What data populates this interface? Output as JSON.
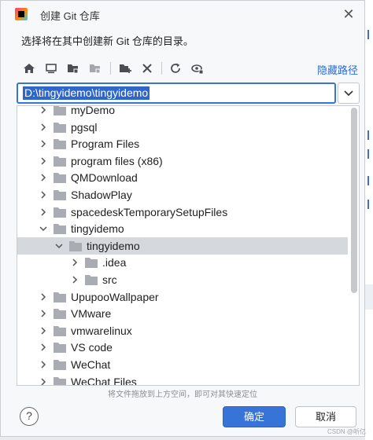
{
  "window": {
    "title": "创建 Git 仓库",
    "close_glyph": "✕"
  },
  "prompt": "选择将在其中创建新 Git 仓库的目录。",
  "toolbar": {
    "icons": [
      "home-icon",
      "desktop-icon",
      "project-folder-icon",
      "module-folder-icon",
      "new-folder-icon",
      "delete-icon",
      "refresh-icon",
      "show-hidden-icon"
    ],
    "hide_path_label": "隐藏路径"
  },
  "path": {
    "value": "D:\\tingyidemo\\tingyidemo"
  },
  "tree": {
    "rows": [
      {
        "label": "myDemo",
        "expanded": false
      },
      {
        "label": "pgsql",
        "expanded": false
      },
      {
        "label": "Program Files",
        "expanded": false
      },
      {
        "label": "program files (x86)",
        "expanded": false
      },
      {
        "label": "QMDownload",
        "expanded": false
      },
      {
        "label": "ShadowPlay",
        "expanded": false
      },
      {
        "label": "spacedeskTemporarySetupFiles",
        "expanded": false
      },
      {
        "label": "tingyidemo",
        "expanded": true
      },
      {
        "label": "tingyidemo",
        "expanded": true,
        "selected": true
      },
      {
        "label": ".idea",
        "expanded": false
      },
      {
        "label": "src",
        "expanded": false
      },
      {
        "label": "UpupooWallpaper",
        "expanded": false
      },
      {
        "label": "VMware",
        "expanded": false
      },
      {
        "label": "vmwarelinux",
        "expanded": false
      },
      {
        "label": "VS code",
        "expanded": false
      },
      {
        "label": "WeChat",
        "expanded": false
      },
      {
        "label": "WeChat Files",
        "expanded": false
      }
    ]
  },
  "hint": "将文件拖放到上方空间，即可对其快速定位",
  "buttons": {
    "help": "?",
    "ok": "确定",
    "cancel": "取消"
  },
  "watermark": "CSDN @听亿",
  "colors": {
    "accent": "#3874d8",
    "link": "#2e6bd6",
    "folder": "#a9adb3",
    "selected_row": "#d5d8dd"
  }
}
